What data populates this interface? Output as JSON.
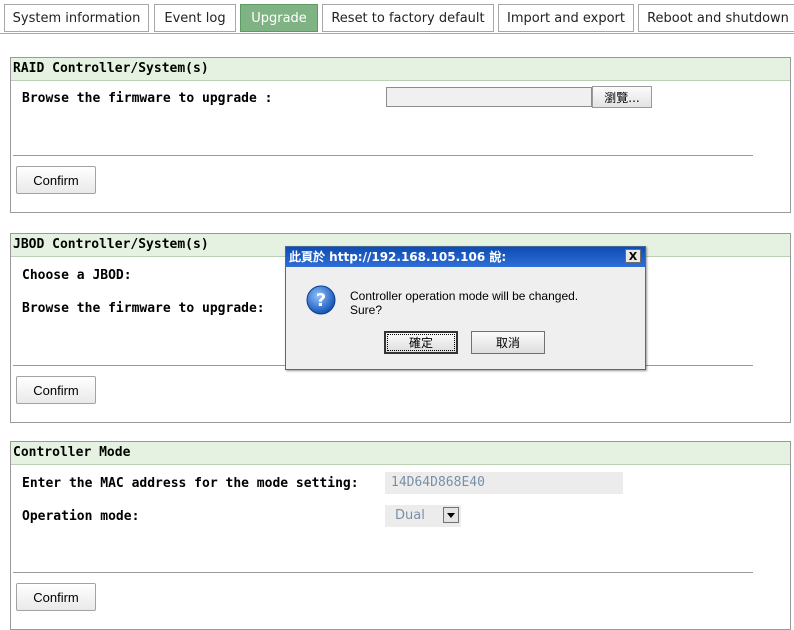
{
  "tabs": [
    {
      "label": "System information",
      "active": false
    },
    {
      "label": "Event log",
      "active": false
    },
    {
      "label": "Upgrade",
      "active": true
    },
    {
      "label": "Reset to factory default",
      "active": false
    },
    {
      "label": "Import and export",
      "active": false
    },
    {
      "label": "Reboot and shutdown",
      "active": false
    }
  ],
  "raid": {
    "title": "RAID Controller/System(s)",
    "browse_label": "Browse the firmware to upgrade :",
    "file_value": "",
    "browse_button": "瀏覽...",
    "confirm": "Confirm"
  },
  "jbod": {
    "title": "JBOD Controller/System(s)",
    "choose_label": "Choose a JBOD:",
    "browse_label": "Browse the firmware to upgrade:",
    "confirm": "Confirm"
  },
  "controller_mode": {
    "title": "Controller Mode",
    "mac_label": "Enter the MAC address for the mode setting:",
    "mac_value": "14D64D868E40",
    "mode_label": "Operation mode:",
    "mode_value": "Dual",
    "confirm": "Confirm"
  },
  "dialog": {
    "title": "此頁於 http://192.168.105.106 說:",
    "close": "X",
    "message_line1": "Controller operation mode will be changed.",
    "message_line2": "Sure?",
    "ok": "確定",
    "cancel": "取消",
    "icon": "question-icon"
  },
  "colors": {
    "active_tab": "#7fb383",
    "panel_header": "#e5f2e1",
    "dialog_title": "#0e4cb2"
  }
}
